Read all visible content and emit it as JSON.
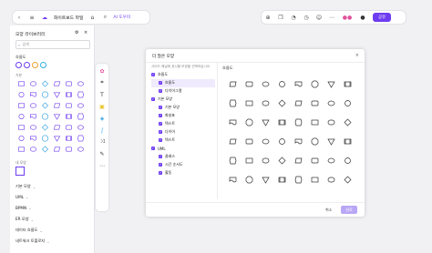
{
  "topbar": {
    "board_title": "화이트보드 파일",
    "ai_tool_label": "AI 도우미",
    "share_label": "공유"
  },
  "shape_panel": {
    "title": "모양 라이브러리",
    "search_placeholder": "검색",
    "section_basic": "흐름도",
    "section_recent": "기본",
    "section_custom": "내 모양",
    "groups": [
      "기본 모양",
      "UML",
      "BPMN",
      "ER 모양",
      "데이터 흐름도",
      "네트워크 토폴로지"
    ]
  },
  "modal": {
    "title": "더 많은 모양",
    "hint": "사이드 패널에 표시할 모양을 선택하십시오.",
    "categories": [
      {
        "label": "흐름도",
        "level": 0
      },
      {
        "label": "흐름도",
        "level": 1,
        "selected": true
      },
      {
        "label": "다이어그램",
        "level": 1
      },
      {
        "label": "기본 모양",
        "level": 0
      },
      {
        "label": "기본 모양",
        "level": 1
      },
      {
        "label": "화살표",
        "level": 1
      },
      {
        "label": "텍스트",
        "level": 1
      },
      {
        "label": "다이어",
        "level": 1
      },
      {
        "label": "텍스트",
        "level": 1
      },
      {
        "label": "UML",
        "level": 0
      },
      {
        "label": "클래스",
        "level": 1
      },
      {
        "label": "시간 순서도",
        "level": 1
      },
      {
        "label": "활동",
        "level": 1
      }
    ],
    "preview_title": "흐름도",
    "cancel_label": "취소",
    "add_label": "완료"
  },
  "colors": {
    "accent": "#6e3cf0",
    "accent_light": "#b9a6f5",
    "shape_stroke": "#6e3cf0"
  }
}
